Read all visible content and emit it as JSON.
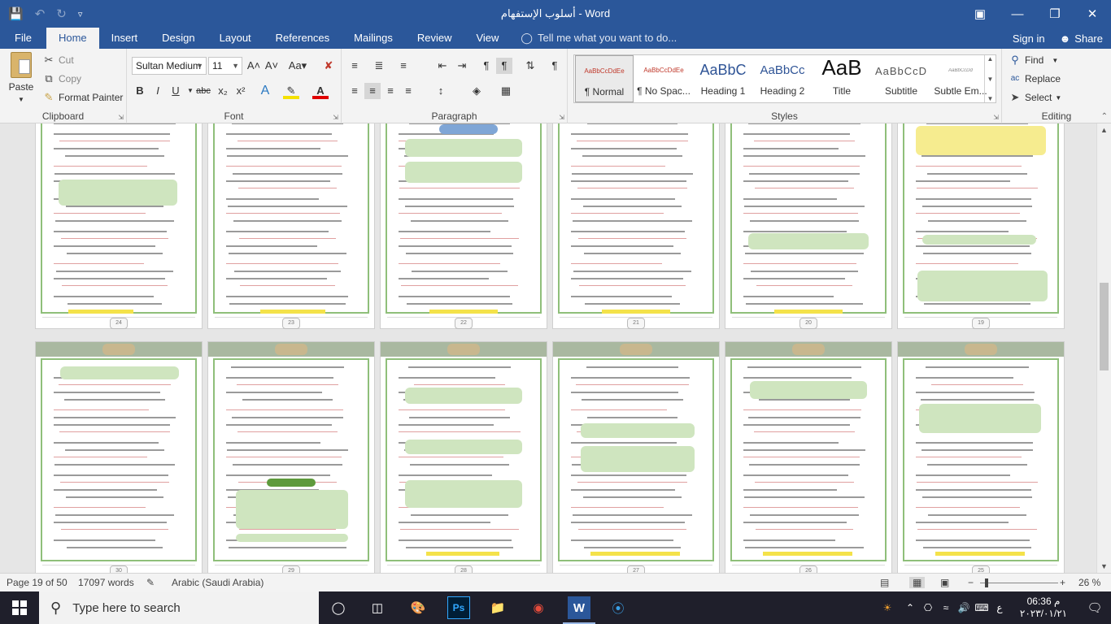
{
  "window": {
    "title": "أسلوب الإستفهام - Word"
  },
  "tabs": [
    "File",
    "Home",
    "Insert",
    "Design",
    "Layout",
    "References",
    "Mailings",
    "Review",
    "View"
  ],
  "active_tab": "Home",
  "tell_me": "Tell me what you want to do...",
  "account": {
    "sign_in": "Sign in",
    "share": "Share"
  },
  "clipboard": {
    "label": "Clipboard",
    "paste": "Paste",
    "cut": "Cut",
    "copy": "Copy",
    "format_painter": "Format Painter"
  },
  "font": {
    "label": "Font",
    "name": "Sultan Medium",
    "size": "11"
  },
  "paragraph": {
    "label": "Paragraph"
  },
  "styles": {
    "label": "Styles",
    "items": [
      {
        "preview": "AaBbCcDdEe",
        "name": "¶ Normal",
        "selected": true
      },
      {
        "preview": "AaBbCcDdEe",
        "name": "¶ No Spac..."
      },
      {
        "preview": "AaBbC",
        "name": "Heading 1"
      },
      {
        "preview": "AaBbCc",
        "name": "Heading 2"
      },
      {
        "preview": "AaB",
        "name": "Title"
      },
      {
        "preview": "AaBbCcD",
        "name": "Subtitle"
      },
      {
        "preview": "AaBbCcDd",
        "name": "Subtle Em..."
      }
    ]
  },
  "editing": {
    "label": "Editing",
    "find": "Find",
    "replace": "Replace",
    "select": "Select"
  },
  "pages_row1": [
    "24",
    "23",
    "22",
    "21",
    "20",
    "19"
  ],
  "pages_row2": [
    "30",
    "29",
    "28",
    "27",
    "26",
    "25"
  ],
  "status": {
    "page": "Page 19 of 50",
    "words": "17097 words",
    "language": "Arabic (Saudi Arabia)",
    "zoom": "26 %"
  },
  "taskbar": {
    "search_placeholder": "Type here to search",
    "time": "06:36 م",
    "date": "٢٠٢٣/٠١/٢١",
    "lang": "ع"
  },
  "colors": {
    "word_blue": "#2b579a",
    "ribbon_bg": "#f3f3f3",
    "page_border_green": "#8fbf7a",
    "highlight_yellow": "#f4e24a"
  }
}
